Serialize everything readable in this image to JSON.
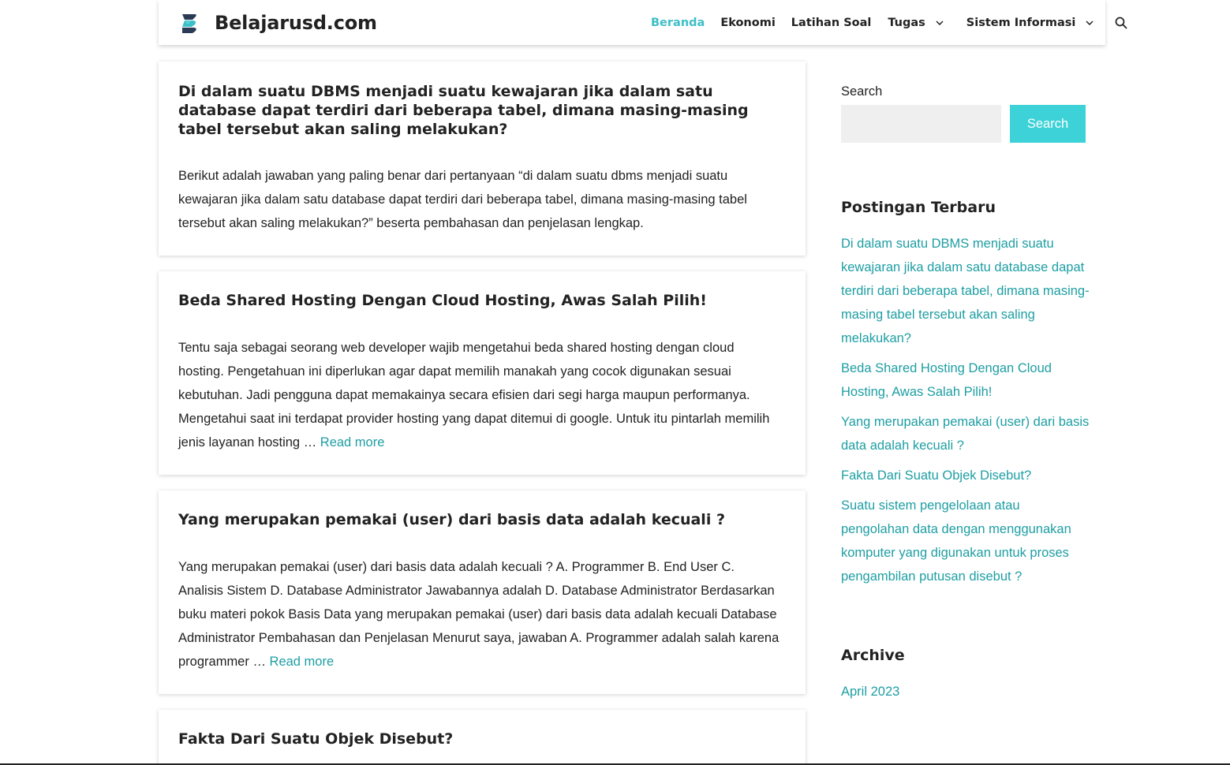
{
  "site": {
    "title": "Belajarusd.com",
    "logo_icon": "brand-s-logo-icon",
    "accent_color": "#3cbfc6",
    "link_color": "#1e9ea3"
  },
  "nav": {
    "items": [
      {
        "label": "Beranda",
        "active": true
      },
      {
        "label": "Ekonomi"
      },
      {
        "label": "Latihan Soal"
      },
      {
        "label": "Tugas",
        "dropdown": true
      },
      {
        "label": "Sistem Informasi",
        "dropdown": true
      }
    ],
    "search_icon": "search-icon"
  },
  "posts": [
    {
      "title": "Di dalam suatu DBMS menjadi suatu kewajaran jika dalam satu database dapat terdiri dari beberapa tabel, dimana masing-masing tabel tersebut akan saling melakukan?",
      "excerpt": "Berikut adalah jawaban yang paling benar dari pertanyaan “di dalam suatu dbms menjadi suatu kewajaran jika dalam satu database dapat terdiri dari beberapa tabel, dimana masing-masing tabel tersebut akan saling melakukan?” beserta pembahasan dan penjelasan lengkap.",
      "read_more": ""
    },
    {
      "title": "Beda Shared Hosting Dengan Cloud Hosting, Awas Salah Pilih!",
      "excerpt": "Tentu saja sebagai seorang web developer wajib mengetahui beda shared hosting dengan cloud hosting. Pengetahuan ini diperlukan agar dapat memilih manakah yang cocok digunakan sesuai kebutuhan. Jadi pengguna dapat memakainya secara efisien dari segi harga maupun performanya. Mengetahui saat ini terdapat provider hosting yang dapat ditemui di google. Untuk itu pintarlah memilih jenis layanan hosting … ",
      "read_more": "Read more"
    },
    {
      "title": "Yang merupakan pemakai (user) dari basis data adalah kecuali ?",
      "excerpt": "Yang merupakan pemakai (user) dari basis data adalah kecuali ? A. Programmer B. End User C. Analisis Sistem D. Database Administrator Jawabannya adalah D. Database Administrator Berdasarkan buku materi pokok Basis Data yang merupakan pemakai (user) dari basis data adalah kecuali Database Administrator Pembahasan dan Penjelasan Menurut saya, jawaban A. Programmer adalah salah karena programmer … ",
      "read_more": "Read more"
    },
    {
      "title": "Fakta Dari Suatu Objek Disebut?",
      "excerpt": "",
      "read_more": ""
    }
  ],
  "sidebar": {
    "search_label": "Search",
    "search_placeholder": "",
    "search_button": "Search",
    "recent_title": "Postingan Terbaru",
    "recent_posts": [
      "Di dalam suatu DBMS menjadi suatu kewajaran jika dalam satu database dapat terdiri dari beberapa tabel, dimana masing-masing tabel tersebut akan saling melakukan?",
      "Beda Shared Hosting Dengan Cloud Hosting, Awas Salah Pilih!",
      "Yang merupakan pemakai (user) dari basis data adalah kecuali ?",
      "Fakta Dari Suatu Objek Disebut?",
      "Suatu sistem pengelolaan atau pengolahan data dengan menggunakan komputer yang digunakan untuk proses pengambilan putusan disebut ?"
    ],
    "archive_title": "Archive",
    "archive_items": [
      "April 2023"
    ]
  }
}
